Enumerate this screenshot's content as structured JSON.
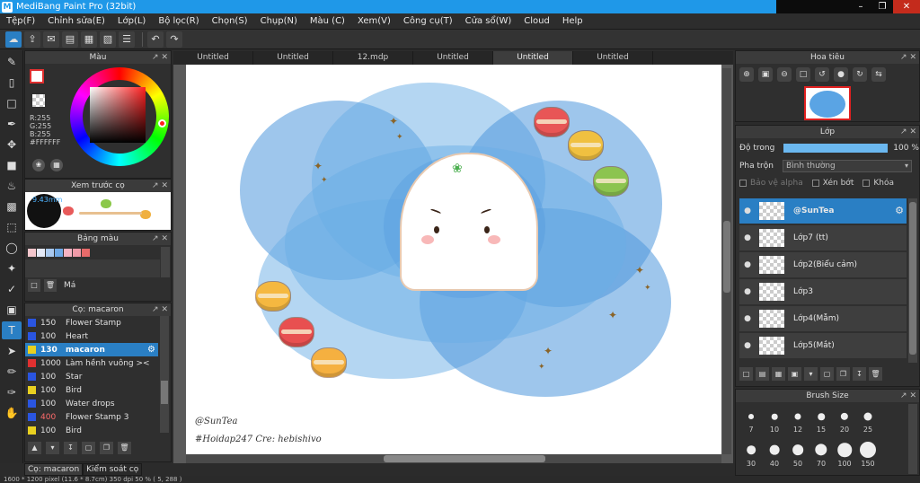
{
  "window": {
    "title": "MediBang Paint Pro (32bit)",
    "app_icon_letter": "M"
  },
  "menu": [
    "Tệp(F)",
    "Chỉnh sửa(E)",
    "Lớp(L)",
    "Bộ lọc(R)",
    "Chọn(S)",
    "Chụp(N)",
    "Màu (C)",
    "Xem(V)",
    "Công cụ(T)",
    "Cửa sổ(W)",
    "Cloud",
    "Help"
  ],
  "color_panel": {
    "title": "Màu",
    "r": "R:255",
    "g": "G:255",
    "b": "B:255",
    "hex": "#FFFFFF"
  },
  "brush_preview": {
    "title": "Xem trước cọ",
    "size": "9.43mm"
  },
  "palette": {
    "title": "Bảng màu",
    "name": "Má",
    "swatches": [
      "#f2c6cc",
      "#e3e8f5",
      "#a8c8ee",
      "#6fa9e6",
      "#f5b3c2",
      "#f09aa8",
      "#e86a6a"
    ]
  },
  "brush_panel": {
    "title": "Cọ: macaron",
    "brushes": [
      {
        "size": "150",
        "name": "Flower Stamp",
        "color": "#2a55e0"
      },
      {
        "size": "100",
        "name": "Heart",
        "color": "#2a55e0"
      },
      {
        "size": "130",
        "name": "macaron",
        "color": "#e8d020"
      },
      {
        "size": "1000",
        "name": "Làm hềnh vuông ><",
        "color": "#e03030"
      },
      {
        "size": "100",
        "name": "Star",
        "color": "#2a55e0"
      },
      {
        "size": "100",
        "name": "Bird",
        "color": "#e8d020"
      },
      {
        "size": "100",
        "name": "Water drops",
        "color": "#2a55e0"
      },
      {
        "size": "400",
        "name": "Flower Stamp 3",
        "color": "#2a55e0"
      },
      {
        "size": "100",
        "name": "Bird",
        "color": "#e8d020"
      }
    ],
    "selected_index": 2
  },
  "bottom_tabs": [
    "Cọ: macaron",
    "Kiểm soát cọ"
  ],
  "status": "1600 * 1200 pixel   (11.6 * 8.7cm)   350 dpi   50 %   ( 5, 288 )",
  "doc_tabs": [
    "Untitled",
    "Untitled",
    "12.mdp",
    "Untitled",
    "Untitled",
    "Untitled"
  ],
  "active_doc_tab": 4,
  "canvas": {
    "signature_1": "@SunTea",
    "signature_2": "#Hoidap247    Cre: hebishivo"
  },
  "navigator": {
    "title": "Hoa tiêu"
  },
  "layer_panel": {
    "title": "Lớp",
    "opacity_label": "Độ trong",
    "opacity_value": "100 %",
    "blend_label": "Pha trộn",
    "blend_value": "Bình thường",
    "protect_alpha": "Bảo vệ alpha",
    "clipping": "Xén bớt",
    "lock": "Khóa",
    "layers": [
      "@SunTea",
      "Lớp7 (tt)",
      "Lớp2(Biểu cảm)",
      "Lớp3",
      "Lớp4(Mẫm)",
      "Lớp5(Mắt)"
    ]
  },
  "brush_size": {
    "title": "Brush Size",
    "sizes": [
      "7",
      "10",
      "12",
      "15",
      "20",
      "25",
      "",
      "30",
      "40",
      "50",
      "70",
      "100",
      "150",
      ""
    ]
  },
  "colors": {
    "accent": "#2a7fc4",
    "titlebar": "#1f98e8",
    "canvas_blue": "#4f98dc"
  }
}
